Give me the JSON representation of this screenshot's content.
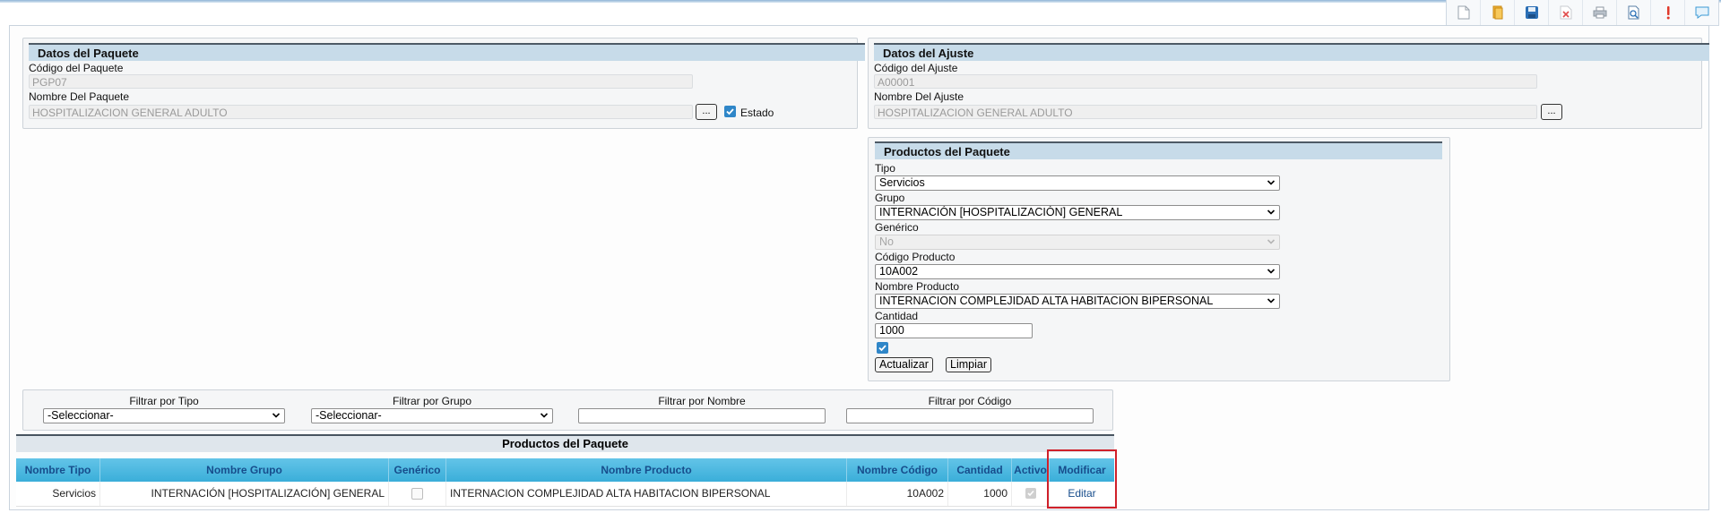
{
  "toolbar": {
    "icons": [
      "new-document-icon",
      "folder-icon",
      "save-icon",
      "delete-icon",
      "print-icon",
      "search-document-icon",
      "alert-icon",
      "comment-icon"
    ]
  },
  "datos_paquete": {
    "title": "Datos del Paquete",
    "codigo_label": "Código del Paquete",
    "codigo_value": "PGP07",
    "nombre_label": "Nombre Del Paquete",
    "nombre_value": "HOSPITALIZACION GENERAL ADULTO",
    "ellipsis": "...",
    "estado_label": "Estado"
  },
  "datos_ajuste": {
    "title": "Datos del Ajuste",
    "codigo_label": "Código del Ajuste",
    "codigo_value": "A00001",
    "nombre_label": "Nombre Del Ajuste",
    "nombre_value": "HOSPITALIZACION GENERAL ADULTO",
    "ellipsis": "..."
  },
  "productos_form": {
    "title": "Productos del Paquete",
    "tipo_label": "Tipo",
    "tipo_value": "Servicios",
    "grupo_label": "Grupo",
    "grupo_value": "INTERNACIÓN [HOSPITALIZACIÓN] GENERAL",
    "generico_label": "Genérico",
    "generico_value": "No",
    "codigo_label": "Código Producto",
    "codigo_value": "10A002",
    "nombre_label": "Nombre Producto",
    "nombre_value": "INTERNACION COMPLEJIDAD ALTA HABITACION BIPERSONAL",
    "cantidad_label": "Cantidad",
    "cantidad_value": "1000",
    "actualizar": "Actualizar",
    "limpiar": "Limpiar"
  },
  "filters": {
    "tipo_label": "Filtrar por Tipo",
    "tipo_value": "-Seleccionar-",
    "grupo_label": "Filtrar por Grupo",
    "grupo_value": "-Seleccionar-",
    "nombre_label": "Filtrar por Nombre",
    "codigo_label": "Filtrar por Código"
  },
  "table": {
    "title": "Productos del Paquete",
    "headers": [
      "Nombre Tipo",
      "Nombre Grupo",
      "Genérico",
      "Nombre Producto",
      "Nombre Código",
      "Cantidad",
      "Activo",
      "Modificar"
    ],
    "rows": [
      {
        "tipo": "Servicios",
        "grupo": "INTERNACIÓN [HOSPITALIZACIÓN] GENERAL",
        "producto": "INTERNACION COMPLEJIDAD ALTA HABITACION BIPERSONAL",
        "codigo": "10A002",
        "cantidad": "1000",
        "editar": "Editar"
      }
    ]
  },
  "colors": {
    "accent": "#3aaed9",
    "header_text": "#174d8c",
    "highlight": "#d0202a"
  }
}
